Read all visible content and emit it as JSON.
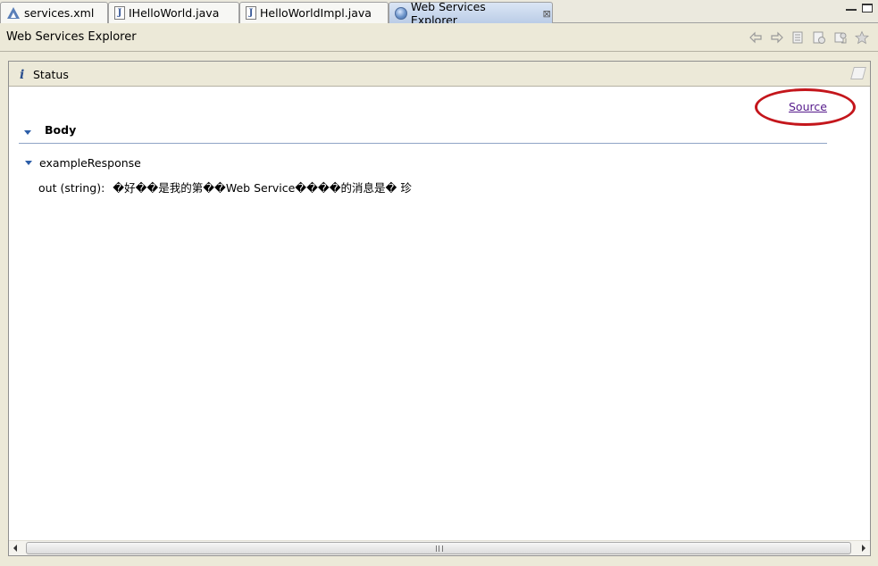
{
  "tabs": [
    {
      "label": "services.xml",
      "icon": "xml-file-icon",
      "active": false
    },
    {
      "label": "IHelloWorld.java",
      "icon": "java-file-icon",
      "active": false
    },
    {
      "label": "HelloWorldImpl.java",
      "icon": "java-file-icon",
      "active": false
    },
    {
      "label": "Web Services Explorer",
      "icon": "globe-icon",
      "active": true
    }
  ],
  "java_icon_letter": "J",
  "close_glyph": "⊠",
  "title": "Web Services Explorer",
  "toolbar": {
    "icons": [
      "back-arrow-icon",
      "forward-arrow-icon",
      "page-icon",
      "properties-icon",
      "wsdl-icon",
      "favorites-icon"
    ]
  },
  "status": {
    "icon_glyph": "i",
    "label": "Status"
  },
  "source_link": "Source",
  "body_section": {
    "title": "Body"
  },
  "response": {
    "node_label": "exampleResponse",
    "field_label": "out (string):",
    "field_value": "�好��是我的第��Web Service����的消息是� 珍"
  },
  "scrollbar": {
    "grip": "Ⅲ"
  },
  "colors": {
    "link": "#551a8b",
    "highlight_ring": "#c4161c",
    "twisty": "#2c5ea8",
    "active_tab": "#b9cbe6"
  }
}
